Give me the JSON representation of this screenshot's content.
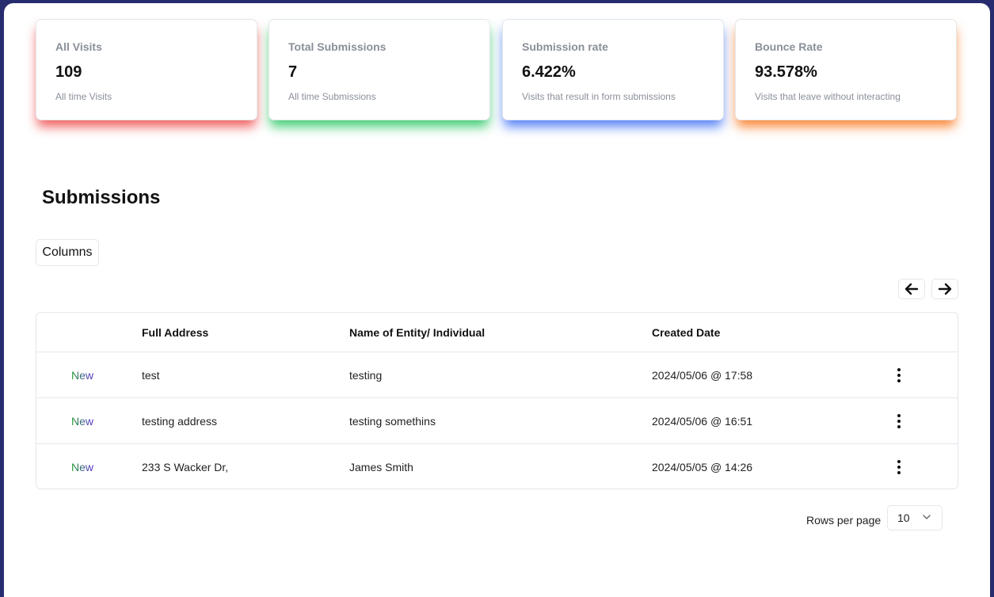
{
  "stats": [
    {
      "label": "All Visits",
      "value": "109",
      "desc": "All time Visits",
      "glow": "#ef4444"
    },
    {
      "label": "Total Submissions",
      "value": "7",
      "desc": "All time Submissions",
      "glow": "#22c55e"
    },
    {
      "label": "Submission rate",
      "value": "6.422%",
      "desc": "Visits that result in form submissions",
      "glow": "#3b6ef6"
    },
    {
      "label": "Bounce Rate",
      "value": "93.578%",
      "desc": "Visits that leave without interacting",
      "glow": "#f97316"
    }
  ],
  "submissions": {
    "title": "Submissions",
    "columns_button": "Columns",
    "headers": [
      "",
      "Full Address",
      "Name of Entity/ Individual",
      "Created Date"
    ],
    "rows": [
      {
        "status": "New",
        "address": "test",
        "name": "testing",
        "created": "2024/05/06 @ 17:58"
      },
      {
        "status": "New",
        "address": "testing address",
        "name": "testing somethins",
        "created": "2024/05/06 @ 16:51"
      },
      {
        "status": "New",
        "address": "233 S Wacker Dr,",
        "name": "James Smith",
        "created": "2024/05/05 @ 14:26"
      }
    ]
  },
  "pagination": {
    "prev_icon": "arrow-left-icon",
    "next_icon": "arrow-right-icon",
    "rows_per_page_label": "Rows per page",
    "rows_per_page_value": "10"
  },
  "colors": {
    "background": "#272c6e",
    "status_gradient_start": "#1f9d2c",
    "status_gradient_end": "#5b2bd8"
  }
}
